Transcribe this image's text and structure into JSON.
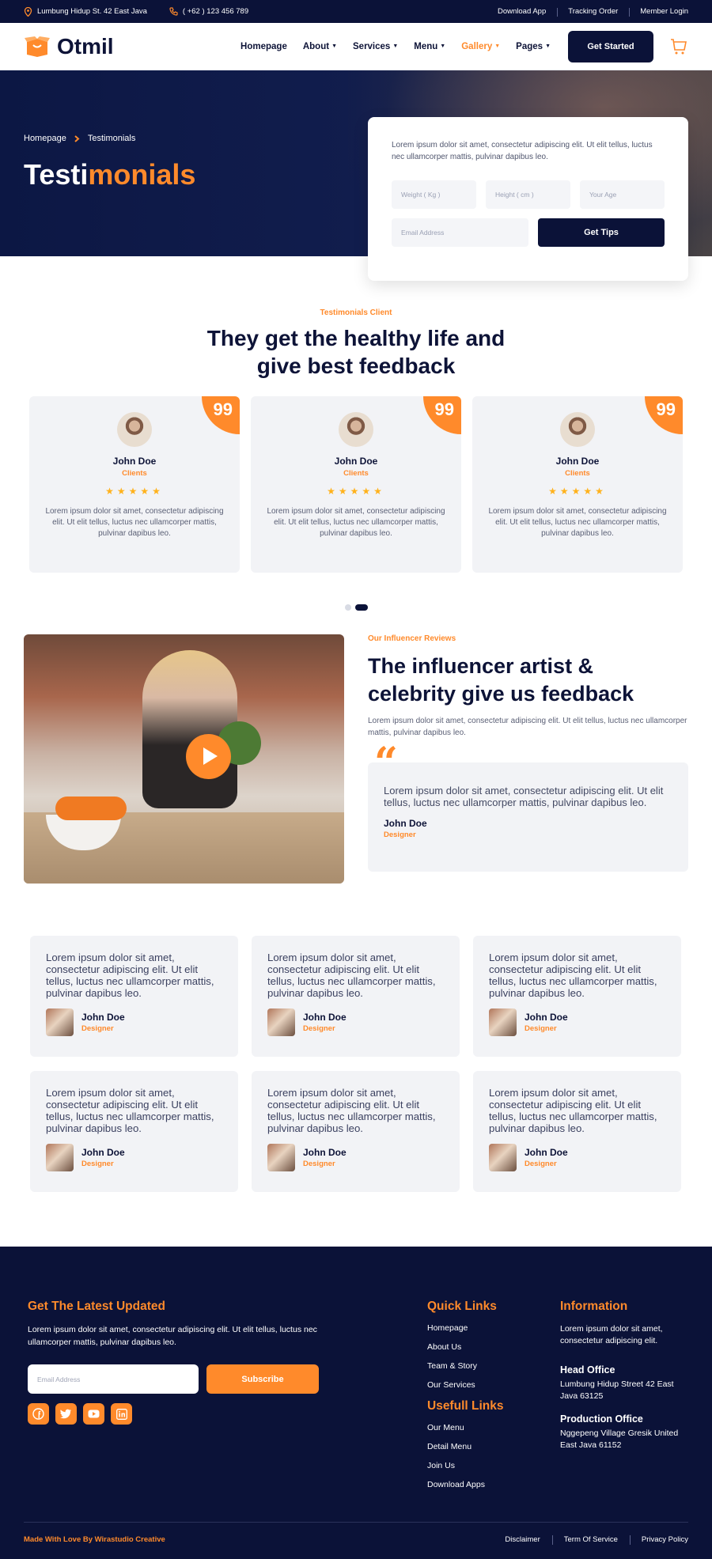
{
  "topbar": {
    "address": "Lumbung Hidup St. 42 East Java",
    "phone": "( +62 ) 123 456 789",
    "links": [
      "Download App",
      "Tracking Order",
      "Member Login"
    ]
  },
  "header": {
    "logo": "Otmil",
    "nav": [
      "Homepage",
      "About",
      "Services",
      "Menu",
      "Gallery",
      "Pages"
    ],
    "active_nav": "Gallery",
    "cta": "Get Started"
  },
  "hero": {
    "breadcrumb": [
      "Homepage",
      "Testimonials"
    ],
    "title_white": "Testi",
    "title_orange": "monials",
    "form_text": "Lorem ipsum dolor sit amet, consectetur adipiscing elit. Ut elit tellus, luctus nec ullamcorper mattis, pulvinar dapibus leo.",
    "weight_ph": "Weight ( Kg )",
    "height_ph": "Height ( cm )",
    "age_ph": "Your Age",
    "email_ph": "Email Address",
    "button": "Get Tips"
  },
  "testimonials": {
    "subtitle": "Testimonials Client",
    "title_line1": "They get the healthy life and",
    "title_line2": "give best feedback",
    "cards": [
      {
        "name": "John Doe",
        "role": "Clients",
        "stars": 5,
        "text": "Lorem ipsum dolor sit amet, consectetur adipiscing elit. Ut elit tellus, luctus nec ullamcorper mattis, pulvinar dapibus leo."
      },
      {
        "name": "John Doe",
        "role": "Clients",
        "stars": 5,
        "text": "Lorem ipsum dolor sit amet, consectetur adipiscing elit. Ut elit tellus, luctus nec ullamcorper mattis, pulvinar dapibus leo."
      },
      {
        "name": "John Doe",
        "role": "Clients",
        "stars": 5,
        "text": "Lorem ipsum dolor sit amet, consectetur adipiscing elit. Ut elit tellus, luctus nec ullamcorper mattis, pulvinar dapibus leo."
      }
    ],
    "quote_glyph": "99",
    "star_glyph": "★★★★★"
  },
  "influencer": {
    "subtitle": "Our Influencer Reviews",
    "title_line1": "The influencer artist &",
    "title_line2": "celebrity give us feedback",
    "description": "Lorem ipsum dolor sit amet, consectetur adipiscing elit. Ut elit tellus, luctus nec ullamcorper mattis, pulvinar dapibus leo.",
    "quote_mark": "“",
    "quote": "Lorem ipsum dolor sit amet, consectetur adipiscing elit. Ut elit tellus, luctus nec ullamcorper mattis, pulvinar dapibus leo.",
    "name": "John Doe",
    "role": "Designer"
  },
  "reviews": [
    {
      "text": "Lorem ipsum dolor sit amet, consectetur adipiscing elit. Ut elit tellus, luctus nec ullamcorper mattis, pulvinar dapibus leo.",
      "name": "John Doe",
      "role": "Designer"
    },
    {
      "text": "Lorem ipsum dolor sit amet, consectetur adipiscing elit. Ut elit tellus, luctus nec ullamcorper mattis, pulvinar dapibus leo.",
      "name": "John Doe",
      "role": "Designer"
    },
    {
      "text": "Lorem ipsum dolor sit amet, consectetur adipiscing elit. Ut elit tellus, luctus nec ullamcorper mattis, pulvinar dapibus leo.",
      "name": "John Doe",
      "role": "Designer"
    },
    {
      "text": "Lorem ipsum dolor sit amet, consectetur adipiscing elit. Ut elit tellus, luctus nec ullamcorper mattis, pulvinar dapibus leo.",
      "name": "John Doe",
      "role": "Designer"
    },
    {
      "text": "Lorem ipsum dolor sit amet, consectetur adipiscing elit. Ut elit tellus, luctus nec ullamcorper mattis, pulvinar dapibus leo.",
      "name": "John Doe",
      "role": "Designer"
    },
    {
      "text": "Lorem ipsum dolor sit amet, consectetur adipiscing elit. Ut elit tellus, luctus nec ullamcorper mattis, pulvinar dapibus leo.",
      "name": "John Doe",
      "role": "Designer"
    }
  ],
  "footer": {
    "news_title": "Get The Latest Updated",
    "news_text": "Lorem ipsum dolor sit amet, consectetur adipiscing elit. Ut elit tellus, luctus nec ullamcorper mattis, pulvinar dapibus leo.",
    "email_ph": "Email Address",
    "subscribe": "Subscribe",
    "social": [
      "facebook-icon",
      "twitter-icon",
      "youtube-icon",
      "linkedin-icon"
    ],
    "quick_title": "Quick Links",
    "quick": [
      "Homepage",
      "About Us",
      "Team & Story",
      "Our Services"
    ],
    "useful_title": "Usefull Links",
    "useful": [
      "Our Menu",
      "Detail Menu",
      "Join Us",
      "Download Apps"
    ],
    "info_title": "Information",
    "info_text": "Lorem ipsum dolor sit amet, consectetur adipiscing elit.",
    "head_office_title": "Head Office",
    "head_office": "Lumbung Hidup Street 42 East Java 63125",
    "prod_office_title": "Production Office",
    "prod_office": "Nggepeng Village Gresik United East Java 61152",
    "made_with": "Made With Love By Wirastudio Creative",
    "bottom_links": [
      "Disclaimer",
      "Term Of Service",
      "Privacy Policy"
    ]
  },
  "colors": {
    "navy": "#0b1238",
    "orange": "#ff8a2b",
    "card_bg": "#f2f3f6"
  }
}
